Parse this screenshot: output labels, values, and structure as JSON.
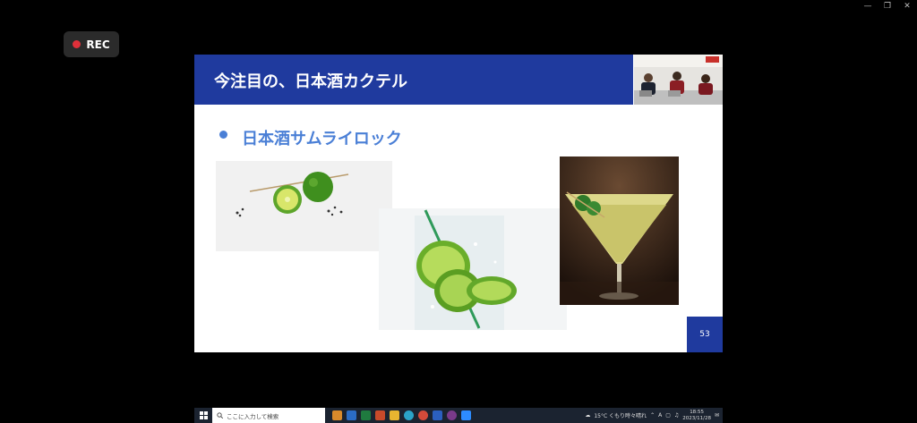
{
  "rec": {
    "label": "REC"
  },
  "slide": {
    "title": "今注目の、日本酒カクテル",
    "bullet": "日本酒サムライロック",
    "page_number": "53"
  },
  "taskbar": {
    "search_placeholder": "ここに入力して検索",
    "weather": "15°C くもり時々晴れ",
    "ime": "A",
    "time": "18:55",
    "date": "2023/11/28"
  }
}
